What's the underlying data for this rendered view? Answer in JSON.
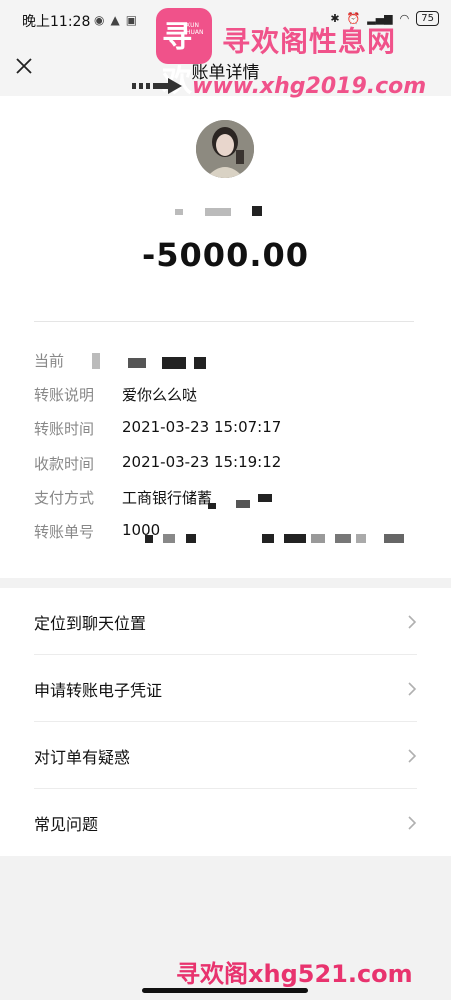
{
  "status_bar": {
    "time": "晚上11:28",
    "battery": "75"
  },
  "header": {
    "title": "账单详情"
  },
  "payee": {
    "amount": "-5000.00"
  },
  "details": [
    {
      "label": "当前",
      "value": ""
    },
    {
      "label": "转账说明",
      "value": "爱你么么哒"
    },
    {
      "label": "转账时间",
      "value": "2021-03-23 15:07:17"
    },
    {
      "label": "收款时间",
      "value": "2021-03-23 15:19:12"
    },
    {
      "label": "支付方式",
      "value": "工商银行储蓄"
    },
    {
      "label": "转账单号",
      "value": "1000"
    }
  ],
  "actions": [
    {
      "label": "定位到聊天位置"
    },
    {
      "label": "申请转账电子凭证"
    },
    {
      "label": "对订单有疑惑"
    },
    {
      "label": "常见问题"
    }
  ],
  "watermark": {
    "logo_text": "寻欢",
    "logo_sub": "XUN HUAN",
    "site_name": "寻欢阁性息网",
    "url": "www.xhg2019.com",
    "bottom": "寻欢阁xhg521.com",
    "color": "#f0528a"
  }
}
